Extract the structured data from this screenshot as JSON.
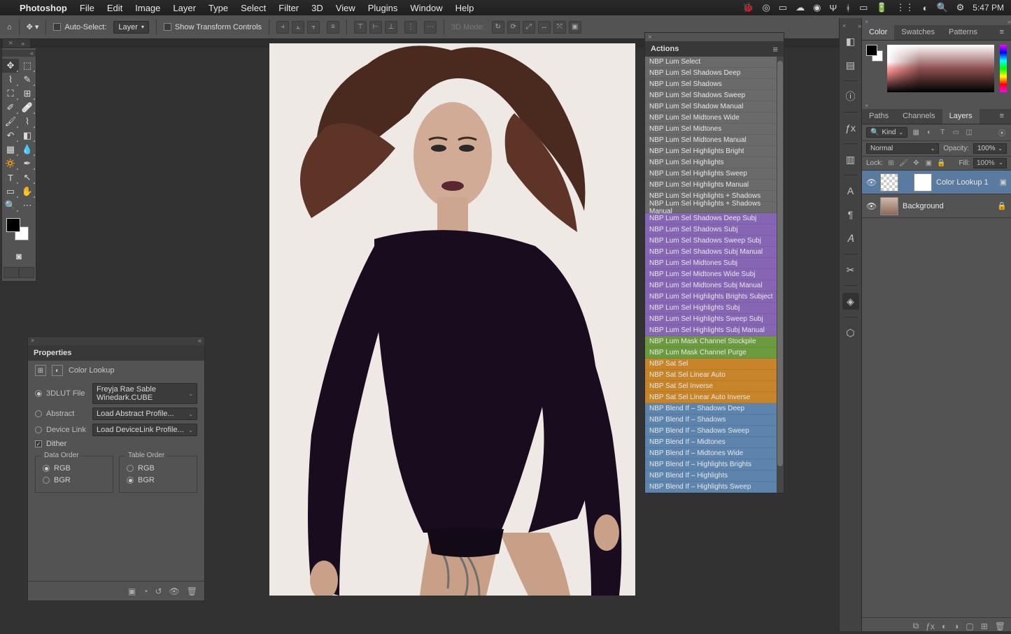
{
  "menubar": {
    "app": "Photoshop",
    "items": [
      "File",
      "Edit",
      "Image",
      "Layer",
      "Type",
      "Select",
      "Filter",
      "3D",
      "View",
      "Plugins",
      "Window",
      "Help"
    ],
    "clock": "5:47 PM"
  },
  "optbar": {
    "auto_select": "Auto-Select:",
    "auto_select_value": "Layer",
    "show_transform": "Show Transform Controls",
    "mode3d": "3D Mode:"
  },
  "doctab": {
    "title": ""
  },
  "actions": {
    "title": "Actions",
    "items": [
      {
        "t": "NBP Lum Select",
        "c": "gray"
      },
      {
        "t": "NBP Lum Sel Shadows Deep",
        "c": "gray"
      },
      {
        "t": "NBP Lum Sel Shadows",
        "c": "gray"
      },
      {
        "t": "NBP Lum Sel Shadows Sweep",
        "c": "gray"
      },
      {
        "t": "NBP Lum Sel Shadow Manual",
        "c": "gray"
      },
      {
        "t": "NBP Lum Sel Midtones Wide",
        "c": "gray"
      },
      {
        "t": "NBP Lum Sel Midtones",
        "c": "gray"
      },
      {
        "t": "NBP Lum Sel Midtones Manual",
        "c": "gray"
      },
      {
        "t": "NBP Lum Sel Highlights Bright",
        "c": "gray"
      },
      {
        "t": "NBP Lum Sel Highlights",
        "c": "gray"
      },
      {
        "t": "NBP Lum Sel Highlights Sweep",
        "c": "gray"
      },
      {
        "t": "NBP Lum Sel Highlights Manual",
        "c": "gray"
      },
      {
        "t": "NBP Lum Sel Highlights + Shadows",
        "c": "gray"
      },
      {
        "t": "NBP Lum Sel Highlights + Shadows Manual",
        "c": "gray"
      },
      {
        "t": "NBP Lum Sel Shadows Deep Subj",
        "c": "purple"
      },
      {
        "t": "NBP Lum Sel Shadows Subj",
        "c": "purple"
      },
      {
        "t": "NBP Lum Sel Shadows Sweep Subj",
        "c": "purple"
      },
      {
        "t": "NBP Lum Sel Shadows Subj Manual",
        "c": "purple"
      },
      {
        "t": "NBP Lum Sel Midtones Subj",
        "c": "purple"
      },
      {
        "t": "NBP Lum Sel Midtones Wide Subj",
        "c": "purple"
      },
      {
        "t": "NBP Lum Sel Midtones Subj Manual",
        "c": "purple"
      },
      {
        "t": "NBP Lum Sel Highlights Brights Subject",
        "c": "purple"
      },
      {
        "t": "NBP Lum Sel Highlights Subj",
        "c": "purple"
      },
      {
        "t": "NBP Lum Sel Highlights Sweep Subj",
        "c": "purple"
      },
      {
        "t": "NBP Lum Sel Highlights Subj Manual",
        "c": "purple"
      },
      {
        "t": "NBP Lum Mask Channel Stockpile",
        "c": "green"
      },
      {
        "t": "NBP Lum Mask Channel Purge",
        "c": "green"
      },
      {
        "t": "NBP Sat Sel",
        "c": "orange"
      },
      {
        "t": "NBP Sat Sel Linear Auto",
        "c": "orange"
      },
      {
        "t": "NBP Sat Sel Inverse",
        "c": "orange"
      },
      {
        "t": "NBP Sat Sel Linear Auto Inverse",
        "c": "orange"
      },
      {
        "t": "NBP Blend If – Shadows Deep",
        "c": "blue"
      },
      {
        "t": "NBP Blend If – Shadows",
        "c": "blue"
      },
      {
        "t": "NBP Blend If – Shadows Sweep",
        "c": "blue"
      },
      {
        "t": "NBP Blend If – Midtones",
        "c": "blue"
      },
      {
        "t": "NBP Blend If – Midtones Wide",
        "c": "blue"
      },
      {
        "t": "NBP Blend If – Highlights Brights",
        "c": "blue"
      },
      {
        "t": "NBP Blend If – Highlights",
        "c": "blue"
      },
      {
        "t": "NBP Blend If – Highlights Sweep",
        "c": "blue"
      }
    ]
  },
  "properties": {
    "title": "Properties",
    "adj": "Color Lookup",
    "lut": "3DLUT File",
    "lut_value": "Freyja Rae Sable Winedark.CUBE",
    "abstract": "Abstract",
    "abstract_value": "Load Abstract Profile...",
    "devlink": "Device Link",
    "devlink_value": "Load DeviceLink Profile...",
    "dither": "Dither",
    "data_order": "Data Order",
    "table_order": "Table Order",
    "rgb": "RGB",
    "bgr": "BGR"
  },
  "color": {
    "tabs": [
      "Color",
      "Swatches",
      "Patterns"
    ]
  },
  "layers": {
    "tabs": [
      "Paths",
      "Channels",
      "Layers"
    ],
    "kind": "Kind",
    "blend_mode": "Normal",
    "opacity_label": "Opacity:",
    "opacity": "100%",
    "lock": "Lock:",
    "fill_label": "Fill:",
    "fill": "100%",
    "items": [
      {
        "name": "Color Lookup 1",
        "sel": true,
        "bg": false
      },
      {
        "name": "Background",
        "sel": false,
        "bg": true
      }
    ]
  }
}
